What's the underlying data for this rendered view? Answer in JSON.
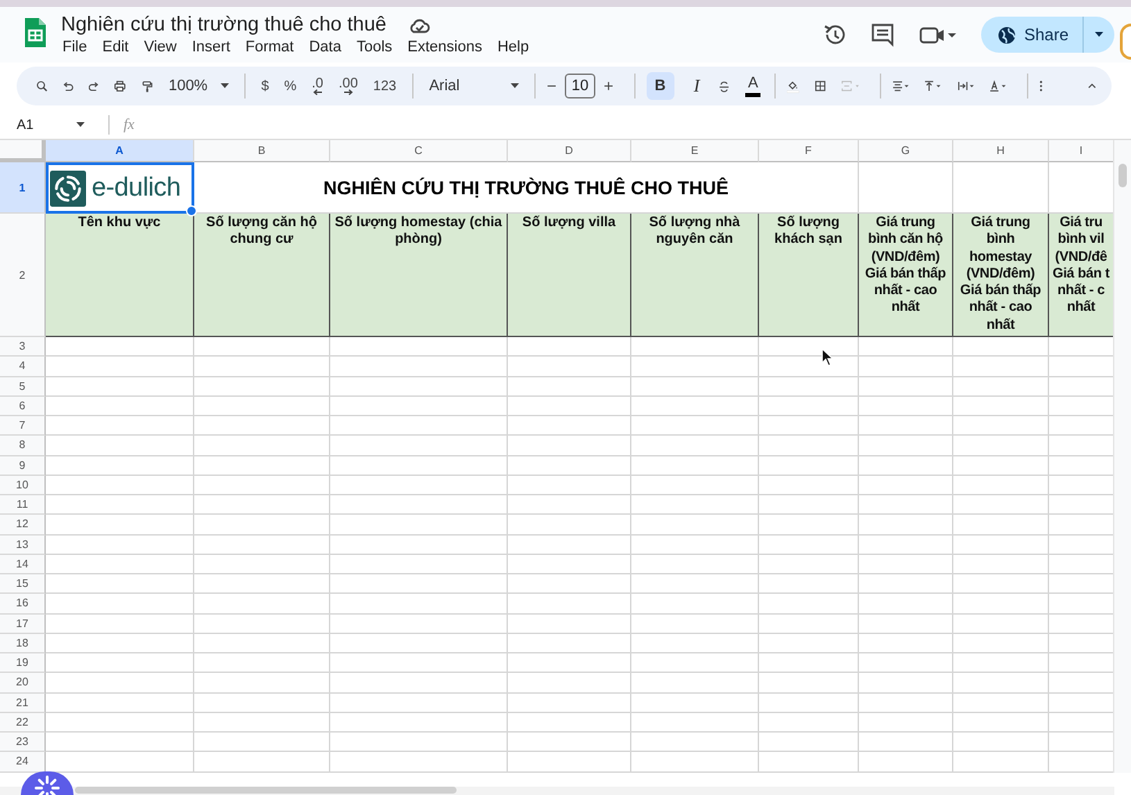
{
  "document": {
    "title": "Nghiên cứu thị trường thuê cho thuê",
    "menu": [
      "File",
      "Edit",
      "View",
      "Insert",
      "Format",
      "Data",
      "Tools",
      "Extensions",
      "Help"
    ]
  },
  "share_button": {
    "label": "Share"
  },
  "toolbar": {
    "zoom": "100%",
    "number_formats": [
      "$",
      "%",
      ".0",
      ".00",
      "123"
    ],
    "font": "Arial",
    "font_size": "10",
    "text_styles": [
      {
        "label": "B",
        "selected": true
      },
      {
        "label": "I",
        "selected": false
      }
    ],
    "text_color": "A"
  },
  "formula_bar": {
    "cell_ref": "A1",
    "fx": "fx"
  },
  "sheet": {
    "columns": [
      {
        "label": "A",
        "selected": true
      },
      {
        "label": "B",
        "selected": false
      },
      {
        "label": "C",
        "selected": false
      },
      {
        "label": "D",
        "selected": false
      },
      {
        "label": "E",
        "selected": false
      },
      {
        "label": "F",
        "selected": false
      },
      {
        "label": "G",
        "selected": false
      },
      {
        "label": "H",
        "selected": false
      },
      {
        "label": "I",
        "selected": false
      }
    ],
    "rows": [
      {
        "label": "1",
        "selected": true
      },
      {
        "label": "2",
        "selected": false
      },
      {
        "label": "3",
        "selected": false
      },
      {
        "label": "4",
        "selected": false
      },
      {
        "label": "5",
        "selected": false
      },
      {
        "label": "6",
        "selected": false
      },
      {
        "label": "7",
        "selected": false
      },
      {
        "label": "8",
        "selected": false
      },
      {
        "label": "9",
        "selected": false
      },
      {
        "label": "10",
        "selected": false
      },
      {
        "label": "11",
        "selected": false
      },
      {
        "label": "12",
        "selected": false
      },
      {
        "label": "13",
        "selected": false
      },
      {
        "label": "14",
        "selected": false
      },
      {
        "label": "15",
        "selected": false
      },
      {
        "label": "16",
        "selected": false
      },
      {
        "label": "17",
        "selected": false
      },
      {
        "label": "18",
        "selected": false
      },
      {
        "label": "19",
        "selected": false
      },
      {
        "label": "20",
        "selected": false
      },
      {
        "label": "21",
        "selected": false
      },
      {
        "label": "22",
        "selected": false
      },
      {
        "label": "23",
        "selected": false
      },
      {
        "label": "24",
        "selected": false
      }
    ],
    "logo_text": "e-dulich",
    "title": "NGHIÊN CỨU THỊ TRƯỜNG THUÊ CHO THUÊ",
    "headers": [
      "Tên khu vực",
      "Số lượng căn hộ chung cư",
      "Số lượng homestay (chia phòng)",
      "Số lượng villa",
      "Số lượng nhà nguyên căn",
      "Số lượng khách sạn",
      "Giá trung\nbình căn hộ\n(VND/đêm)\nGiá bán thấp\nnhất - cao\nnhất",
      "Giá trung\nbình\nhomestay\n(VND/đêm)\nGiá bán thấp\nnhất - cao\nnhất",
      "Giá tru\nbình vil\n(VND/đê\nGiá bán t\nnhất - c\nnhất"
    ]
  }
}
